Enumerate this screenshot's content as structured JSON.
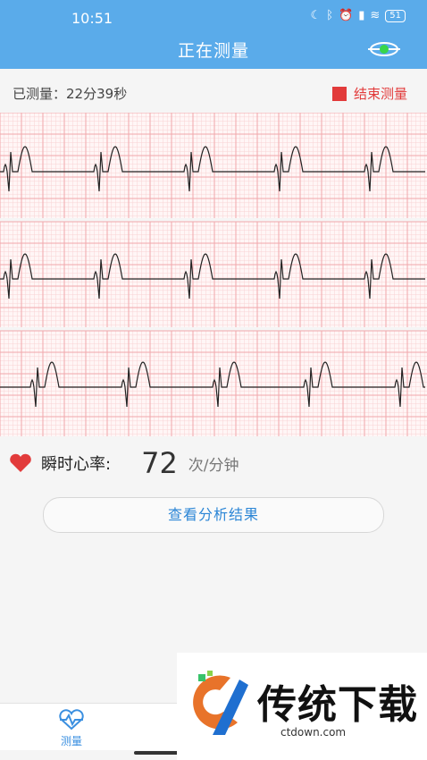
{
  "status_bar": {
    "time": "10:51",
    "battery": "51"
  },
  "header": {
    "title": "正在测量"
  },
  "measure": {
    "elapsed_label": "已测量：",
    "elapsed_value": "22分39秒",
    "stop_label": "结束测量"
  },
  "heart_rate": {
    "label": "瞬时心率:",
    "value": "72",
    "unit": "次/分钟"
  },
  "actions": {
    "view_results": "查看分析结果"
  },
  "tabbar": {
    "tab_label": "测量"
  },
  "watermark": {
    "text": "传统下载",
    "url": "ctdown.com"
  },
  "colors": {
    "header_bg": "#5aabea",
    "stop_red": "#e23b3b",
    "link_blue": "#2c86d6",
    "grid_pink": "#f4a3a8"
  }
}
